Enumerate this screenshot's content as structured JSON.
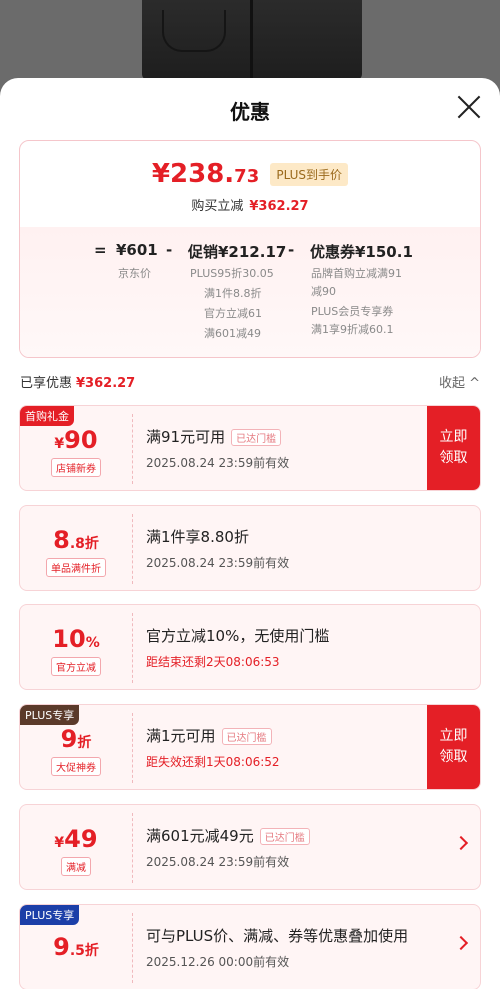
{
  "header": {
    "title": "优惠"
  },
  "summary": {
    "price_int": "¥238.",
    "price_dec": "73",
    "plus_badge": "PLUS到手价",
    "save_label": "购买立减",
    "save_amount": "¥362.27",
    "formula": {
      "eq": "=",
      "jd_price": "¥601",
      "minus1": "-",
      "promo": "促销¥212.17",
      "minus2": "-",
      "coupon": "优惠券¥150.1"
    },
    "jd_label": "京东价",
    "promo_lines": [
      "PLUS95折30.05",
      "满1件8.8折",
      "官方立减61",
      "满601减49"
    ],
    "coupon_lines": [
      "品牌首购立减满91",
      "减90",
      "PLUS会员专享券",
      "满1享9折减60.1"
    ]
  },
  "enjoyed": {
    "label": "已享优惠",
    "amount": "¥362.27",
    "collapse": "收起 ^"
  },
  "coupons": [
    {
      "tag": "首购礼金",
      "amount_main": "90",
      "amount_prefix": "¥",
      "amount_suffix": "",
      "label": "店铺新券",
      "title": "满91元可用",
      "chip": "已达门槛",
      "sub": "2025.08.24 23:59前有效",
      "action": "立即领取"
    },
    {
      "tag": "",
      "amount_main": "8",
      "amount_prefix": "",
      "amount_suffix": ".8折",
      "label": "单品满件折",
      "title": "满1件享8.80折",
      "chip": "",
      "sub": "2025.08.24 23:59前有效",
      "action": ""
    },
    {
      "tag": "",
      "amount_main": "10",
      "amount_prefix": "",
      "amount_suffix": "%",
      "label": "官方立减",
      "title": "官方立减10%，无使用门槛",
      "chip": "",
      "sub": "距结束还剩2天08:06:53",
      "action": ""
    },
    {
      "tag": "PLUS专享",
      "amount_main": "9",
      "amount_prefix": "",
      "amount_suffix": "折",
      "label": "大促神券",
      "title": "满1元可用",
      "chip": "已达门槛",
      "sub": "距失效还剩1天08:06:52",
      "action": "立即领取"
    },
    {
      "tag": "",
      "amount_main": "49",
      "amount_prefix": "¥",
      "amount_suffix": "",
      "label": "满减",
      "title": "满601元减49元",
      "chip": "已达门槛",
      "sub": "2025.08.24 23:59前有效",
      "action": ""
    },
    {
      "tag": "PLUS专享",
      "amount_main": "9",
      "amount_prefix": "",
      "amount_suffix": ".5折",
      "label": "",
      "title": "可与PLUS价、满减、券等优惠叠加使用",
      "chip": "",
      "sub": "2025.12.26 00:00前有效",
      "action": ""
    }
  ],
  "colors": {
    "accent": "#e41f26",
    "plus_gold": "#fde9c7",
    "plus_brown": "#5b3a2a",
    "plus_blue": "#1c3fa8"
  }
}
